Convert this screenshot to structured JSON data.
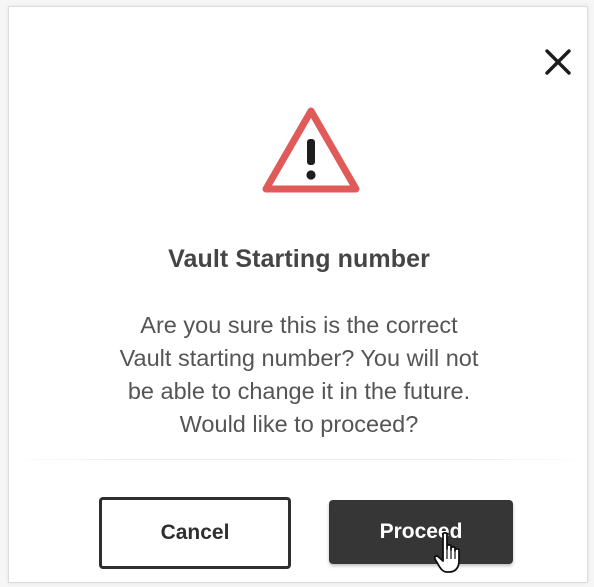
{
  "dialog": {
    "title": "Vault Starting number",
    "message_lines": [
      "Are you sure this is the correct",
      "Vault starting number? You will not",
      "be able to change it in the future.",
      "Would like to proceed?"
    ],
    "close_icon": "close-icon",
    "warning_icon": "warning-triangle-icon"
  },
  "buttons": {
    "cancel_label": "Cancel",
    "proceed_label": "Proceed"
  },
  "cursor": {
    "type": "hand-pointer"
  },
  "colors": {
    "warning": "#e05a5a",
    "proceed_bg": "#363636",
    "title": "#454545",
    "text": "#555555"
  }
}
